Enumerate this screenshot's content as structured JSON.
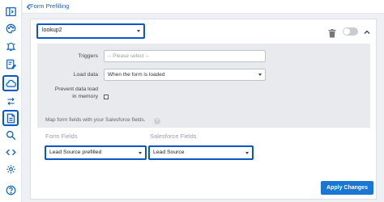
{
  "header": {
    "title": "Form Prefilling"
  },
  "rail": {
    "items": [
      {
        "icon": "collapse-sidebar-icon",
        "selected": false
      },
      {
        "icon": "palette-icon",
        "selected": false
      },
      {
        "icon": "notification-icon",
        "selected": false
      },
      {
        "icon": "form-edit-icon",
        "selected": false
      },
      {
        "icon": "cloud-icon",
        "selected": true
      },
      {
        "icon": "arrows-icon",
        "selected": false
      },
      {
        "icon": "document-icon",
        "selected": true
      },
      {
        "icon": "search-icon",
        "selected": false
      },
      {
        "icon": "code-icon",
        "selected": false
      },
      {
        "icon": "settings-icon",
        "selected": false
      },
      {
        "icon": "help-icon",
        "selected": false
      }
    ]
  },
  "lookup": {
    "selected": "lookup2"
  },
  "settings": {
    "triggers_label": "Triggers",
    "triggers_placeholder": "-- Please select --",
    "load_data_label": "Load data",
    "load_data_value": "When the form is loaded",
    "prevent_label_line1": "Prevent data load",
    "prevent_label_line2": "in memory",
    "prevent_checked": false
  },
  "mapping": {
    "title": "Map form fields with your Salesforce fields.",
    "help": "?",
    "form_fields_header": "Form Fields",
    "salesforce_fields_header": "Salesforce Fields",
    "form_field_value": "Lead Source prefilled",
    "salesforce_field_value": "Lead Source"
  },
  "actions": {
    "apply_label": "Apply Changes"
  },
  "colors": {
    "accent": "#1976d2",
    "highlight": "#0a57c9"
  }
}
